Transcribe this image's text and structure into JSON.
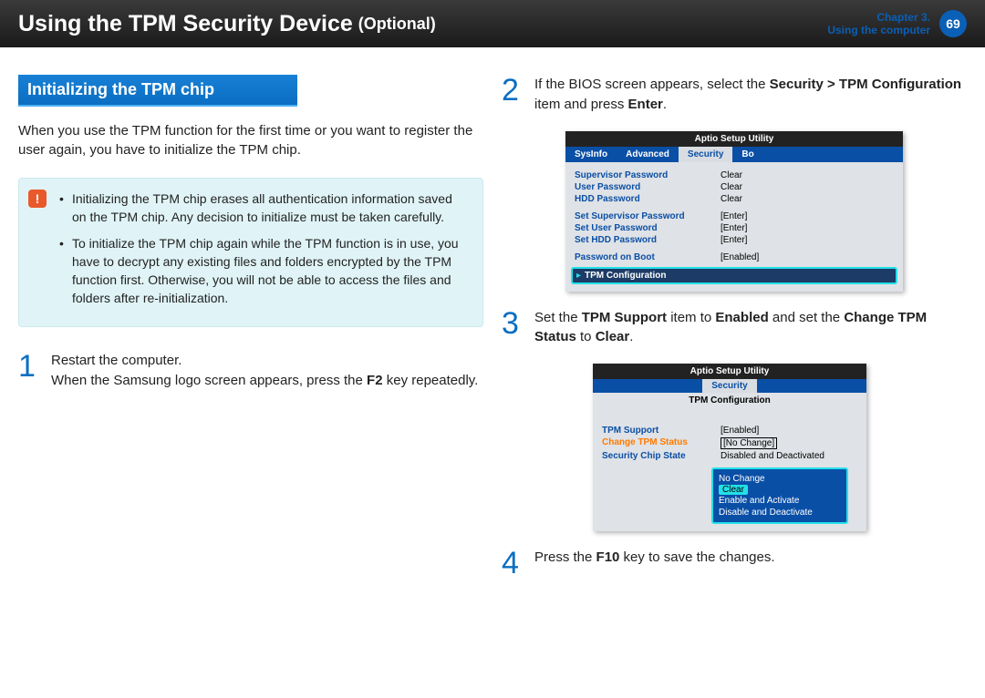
{
  "header": {
    "title": "Using the TPM Security Device",
    "optional": "(Optional)",
    "chapter_line1": "Chapter 3.",
    "chapter_line2": "Using the computer",
    "page_num": "69"
  },
  "section_heading": "Initializing the TPM chip",
  "intro_para": "When you use the TPM function for the first time or you want to register the user again, you have to initialize the TPM chip.",
  "info": {
    "bullet1": "Initializing the TPM chip erases all authentication information saved on the TPM chip. Any decision to initialize must be taken carefully.",
    "bullet2": "To initialize the TPM chip again while the TPM function is in use, you have to decrypt any existing files and folders encrypted by the TPM function first. Otherwise, you will not be able to access the files and folders after re-initialization."
  },
  "steps": {
    "s1": {
      "num": "1",
      "p1": "Restart the computer.",
      "p2a": "When the Samsung logo screen appears, press the ",
      "p2b": "F2",
      "p2c": " key repeatedly."
    },
    "s2": {
      "num": "2",
      "p_a": "If the BIOS screen appears, select the ",
      "p_b": "Security > TPM Configuration",
      "p_c": " item and press ",
      "p_d": "Enter",
      "p_e": "."
    },
    "s3": {
      "num": "3",
      "p_a": "Set the ",
      "p_b": "TPM Support",
      "p_c": " item to ",
      "p_d": "Enabled",
      "p_e": " and set the ",
      "p_f": "Change TPM Status",
      "p_g": " to ",
      "p_h": "Clear",
      "p_i": "."
    },
    "s4": {
      "num": "4",
      "p_a": "Press the ",
      "p_b": "F10",
      "p_c": " key to save the changes."
    }
  },
  "bios1": {
    "utility": "Aptio Setup Utility",
    "tabs": {
      "a": "SysInfo",
      "b": "Advanced",
      "c": "Security",
      "d": "Bo"
    },
    "rows": {
      "r1k": "Supervisor Password",
      "r1v": "Clear",
      "r2k": "User Password",
      "r2v": "Clear",
      "r3k": "HDD Password",
      "r3v": "Clear",
      "r4k": "Set Supervisor Password",
      "r4v": "[Enter]",
      "r5k": "Set User Password",
      "r5v": "[Enter]",
      "r6k": "Set HDD Password",
      "r6v": "[Enter]",
      "r7k": "Password on Boot",
      "r7v": "[Enabled]",
      "r8k": "TPM Configuration"
    }
  },
  "bios2": {
    "utility": "Aptio Setup Utility",
    "tab": "Security",
    "subtitle": "TPM Configuration",
    "rows": {
      "r1k": "TPM Support",
      "r1v": "[Enabled]",
      "r2k": "Change TPM Status",
      "r2v": "[No Change]",
      "r3k": "Security Chip State",
      "r3v": "Disabled and Deactivated"
    },
    "dropdown": {
      "o1": "No Change",
      "o2": "Clear",
      "o3": "Enable and Activate",
      "o4": "Disable and Deactivate"
    }
  }
}
